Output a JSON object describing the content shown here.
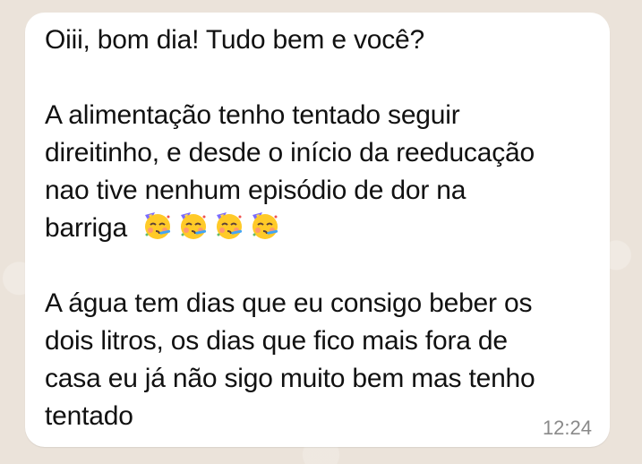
{
  "message": {
    "line_1": "Oiii, bom dia! Tudo bem e você?",
    "line_2": "A alimentação tenho tentado seguir",
    "line_3": "direitinho, e desde o início da reeducação",
    "line_4": "nao tive nenhum episódio de dor na",
    "line_5": "barriga",
    "line_6": "A água tem dias que eu consigo beber os",
    "line_7": "dois litros, os dias que fico mais fora de",
    "line_8": "casa eu já não sigo muito bem mas tenho",
    "line_9": "tentado",
    "emoji_icon": "partying-face-icon",
    "emoji_count": 4,
    "timestamp": "12:24"
  },
  "colors": {
    "bubble": "#ffffff",
    "text": "#111111",
    "timestamp": "#8a8a8a",
    "wallpaper": "#ebe3da"
  }
}
